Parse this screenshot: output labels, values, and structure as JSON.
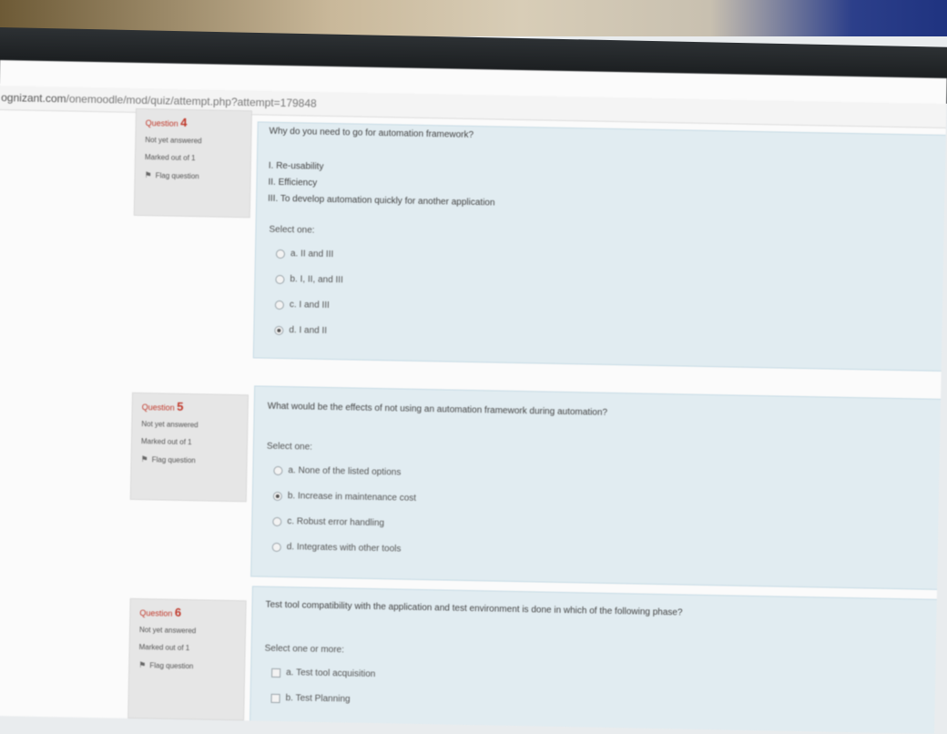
{
  "browser": {
    "url_domain": "ognizant.com",
    "url_path": "/onemoodle/mod/quiz/attempt.php?attempt=179848"
  },
  "questions": [
    {
      "number_label": "Question",
      "number": "4",
      "state": "Not yet answered",
      "grade": "Marked out of 1",
      "flag_label": "Flag question",
      "text": "Why do you need to go for automation framework?",
      "premises": [
        "I. Re-usability",
        "II. Efficiency",
        "III. To develop automation quickly for another application"
      ],
      "prompt": "Select one:",
      "options": [
        {
          "label": "a. II and III",
          "selected": false
        },
        {
          "label": "b. I, II, and III",
          "selected": false
        },
        {
          "label": "c. I and III",
          "selected": false
        },
        {
          "label": "d. I and II",
          "selected": true
        }
      ]
    },
    {
      "number_label": "Question",
      "number": "5",
      "state": "Not yet answered",
      "grade": "Marked out of 1",
      "flag_label": "Flag question",
      "text": "What would be the effects of not using an automation framework during automation?",
      "prompt": "Select one:",
      "options": [
        {
          "label": "a. None of the listed options",
          "selected": false
        },
        {
          "label": "b. Increase in maintenance cost",
          "selected": true
        },
        {
          "label": "c. Robust error handling",
          "selected": false
        },
        {
          "label": "d. Integrates with other tools",
          "selected": false
        }
      ]
    },
    {
      "number_label": "Question",
      "number": "6",
      "state": "Not yet answered",
      "grade": "Marked out of 1",
      "flag_label": "Flag question",
      "text": "Test tool compatibility with the application and test environment is done in which of the following phase?",
      "prompt": "Select one or more:",
      "options": [
        {
          "label": "a. Test tool acquisition"
        },
        {
          "label": "b. Test Planning"
        }
      ]
    }
  ]
}
